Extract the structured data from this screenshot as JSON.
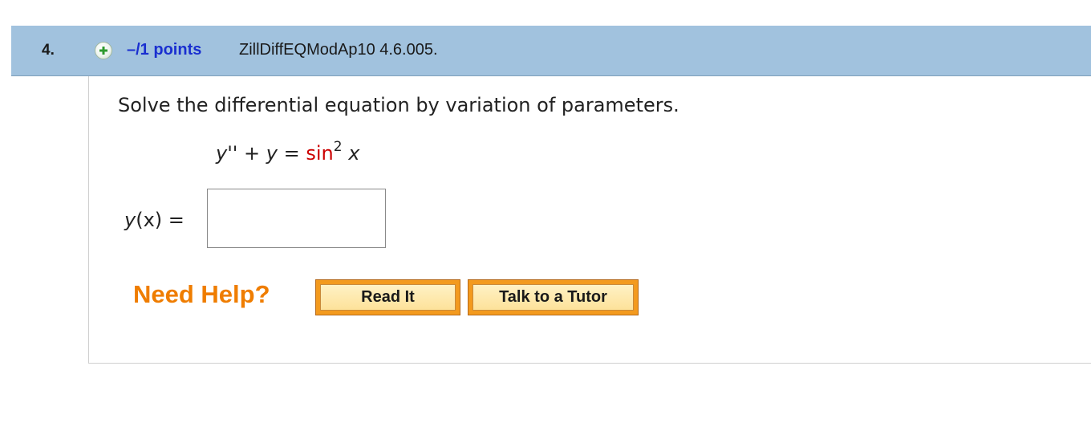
{
  "question": {
    "number": "4.",
    "expand_icon": "plus-circle-icon",
    "points": "–/1 points",
    "problem_code": "ZillDiffEQModAp10 4.6.005."
  },
  "body": {
    "prompt": "Solve the differential equation by variation of parameters.",
    "equation": {
      "lhs": "y'' + y",
      "equals": "=",
      "func": "sin",
      "exponent": "2",
      "arg": "x"
    },
    "answer": {
      "label_var": "y",
      "label_rest": "(x) =",
      "value": "",
      "placeholder": ""
    }
  },
  "help": {
    "label": "Need Help?",
    "read_it": "Read It",
    "talk_tutor": "Talk to a Tutor"
  },
  "colors": {
    "header_bg": "#a1c2de",
    "points_text": "#1a2fd0",
    "need_help": "#ef7d00",
    "highlight_red": "#cc0000"
  }
}
